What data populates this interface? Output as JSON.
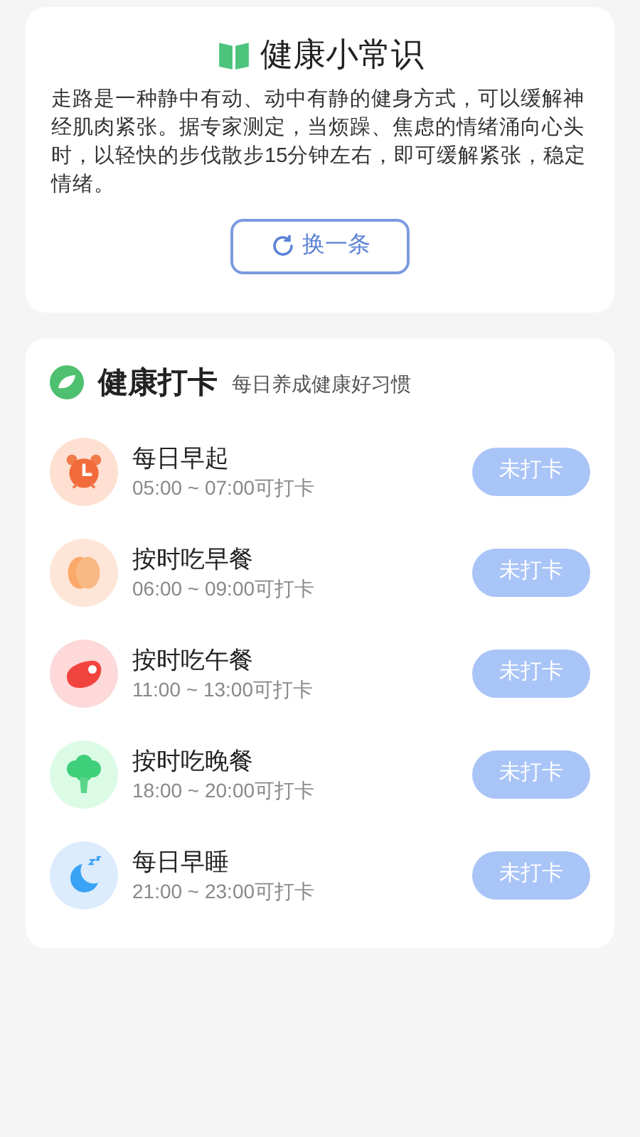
{
  "tip": {
    "title": "健康小常识",
    "text": "走路是一种静中有动、动中有静的健身方式，可以缓解神经肌肉紧张。据专家测定，当烦躁、焦虑的情绪涌向心头时，以轻快的步伐散步15分钟左右，即可缓解紧张，稳定情绪。",
    "button": "换一条"
  },
  "checkin": {
    "title": "健康打卡",
    "subtitle": "每日养成健康好习惯",
    "items": [
      {
        "kind": "alarm",
        "name": "每日早起",
        "time": "05:00 ~ 07:00可打卡",
        "button": "未打卡",
        "checked": false
      },
      {
        "kind": "peach",
        "name": "按时吃早餐",
        "time": "06:00 ~ 09:00可打卡",
        "button": "未打卡",
        "checked": false
      },
      {
        "kind": "meat",
        "name": "按时吃午餐",
        "time": "11:00 ~ 13:00可打卡",
        "button": "未打卡",
        "checked": false
      },
      {
        "kind": "broccoli",
        "name": "按时吃晚餐",
        "time": "18:00 ~ 20:00可打卡",
        "button": "未打卡",
        "checked": false
      },
      {
        "kind": "moon",
        "name": "每日早睡",
        "time": "21:00 ~ 23:00可打卡",
        "button": "未打卡",
        "checked": false
      }
    ]
  }
}
